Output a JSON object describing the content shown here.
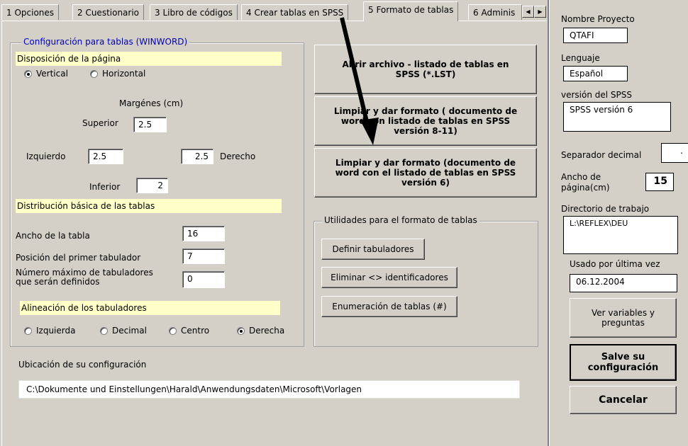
{
  "tabs": [
    {
      "label": "1 Opciones"
    },
    {
      "label": "2 Cuestionario"
    },
    {
      "label": "3 Libro de códigos"
    },
    {
      "label": "4 Crear tablas en SPSS"
    },
    {
      "label": "5 Formato de tablas"
    },
    {
      "label": "6 Adminis"
    }
  ],
  "word_config": {
    "legend": "Configuración para tablas (WINWORD)",
    "page_layout_label": "Disposición de la página",
    "orientation": {
      "vertical": "Vertical",
      "horizontal": "Horizontal",
      "selected": "Vertical"
    },
    "margins_label": "Margénes (cm)",
    "superior_label": "Superior",
    "superior_value": "2.5",
    "izquierdo_label": "Izquierdo",
    "izquierdo_value": "2.5",
    "derecho_label": "Derecho",
    "derecho_value": "2.5",
    "inferior_label": "Inferior",
    "inferior_value": "2",
    "distribution_label": "Distribución básica de las tablas",
    "table_width_label": "Ancho de la tabla",
    "table_width_value": "16",
    "first_tab_label": "Posición del primer tabulador",
    "first_tab_value": "7",
    "max_tabs_label_1": "Número máximo de tabuladores",
    "max_tabs_label_2": "que serán definidos",
    "max_tabs_value": "0",
    "alignment_label": "Alineación de los tabuladores",
    "alignment": {
      "izquierda": "Izquierda",
      "decimal": "Decimal",
      "centro": "Centro",
      "derecha": "Derecha",
      "selected": "Derecha"
    }
  },
  "actions": {
    "open_file": "Abrir archivo - listado de tablas en SPSS (*.LST)",
    "clean_8_11": "Limpiar y dar formato ( documento de word con listado de tablas en SPSS versión 8-11)",
    "clean_6": "Limpiar y dar formato (documento de word con el listado de tablas en SPSS versión 6)"
  },
  "utilities": {
    "legend": "Utilidades para el formato de tablas",
    "define_tabs": "Definir tabuladores",
    "remove_ids": "Eliminar <> identificadores",
    "enumerate": "Enumeración de tablas (#)"
  },
  "config_location": {
    "label": "Ubicación de su configuración",
    "path": "C:\\Dokumente und Einstellungen\\Harald\\Anwendungsdaten\\Microsoft\\Vorlagen"
  },
  "right_panel": {
    "project_name_label": "Nombre Proyecto",
    "project_name": "QTAFI",
    "language_label": "Lenguaje",
    "language": "Español",
    "spss_version_label": "versión del SPSS",
    "spss_version": "SPSS versión 6",
    "decimal_sep_label": "Separador decimal",
    "decimal_sep": ".",
    "page_width_label_1": "Ancho de",
    "page_width_label_2": "página(cm)",
    "page_width": "15",
    "workdir_label": "Directorio de trabajo",
    "workdir": "L:\\REFLEX\\DEU",
    "last_used_label": "Usado por última vez",
    "last_used": "06.12.2004",
    "view_vars_btn": "Ver variables y preguntas",
    "save_btn": "Salve su configuración",
    "cancel_btn": "Cancelar"
  },
  "colors": {
    "highlight": "#ffffc8",
    "legend_blue": "#0000c0",
    "face": "#d4d0c8"
  }
}
